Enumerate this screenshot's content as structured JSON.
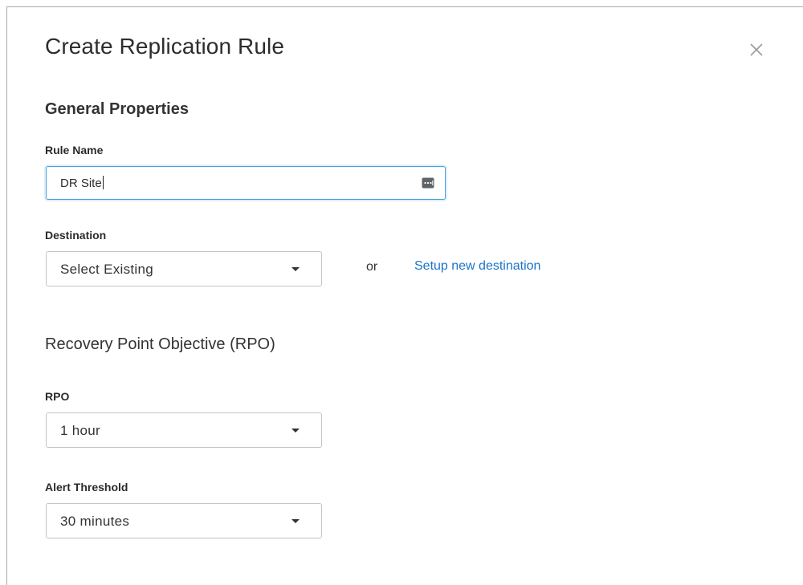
{
  "dialog": {
    "title": "Create Replication Rule",
    "close_icon": "close-icon"
  },
  "general": {
    "heading": "General Properties",
    "rule_name": {
      "label": "Rule Name",
      "value": "DR Site",
      "trailing_icon": "password-manager-icon"
    },
    "destination": {
      "label": "Destination",
      "selected": "Select Existing",
      "or_text": "or",
      "link_label": "Setup new destination"
    }
  },
  "rpo_section": {
    "heading": "Recovery Point Objective (RPO)",
    "rpo": {
      "label": "RPO",
      "selected": "1 hour"
    },
    "alert_threshold": {
      "label": "Alert Threshold",
      "selected": "30 minutes"
    }
  },
  "colors": {
    "accent": "#1a73c7",
    "focus_border": "#49a3e0",
    "border": "#c4c4c4"
  }
}
